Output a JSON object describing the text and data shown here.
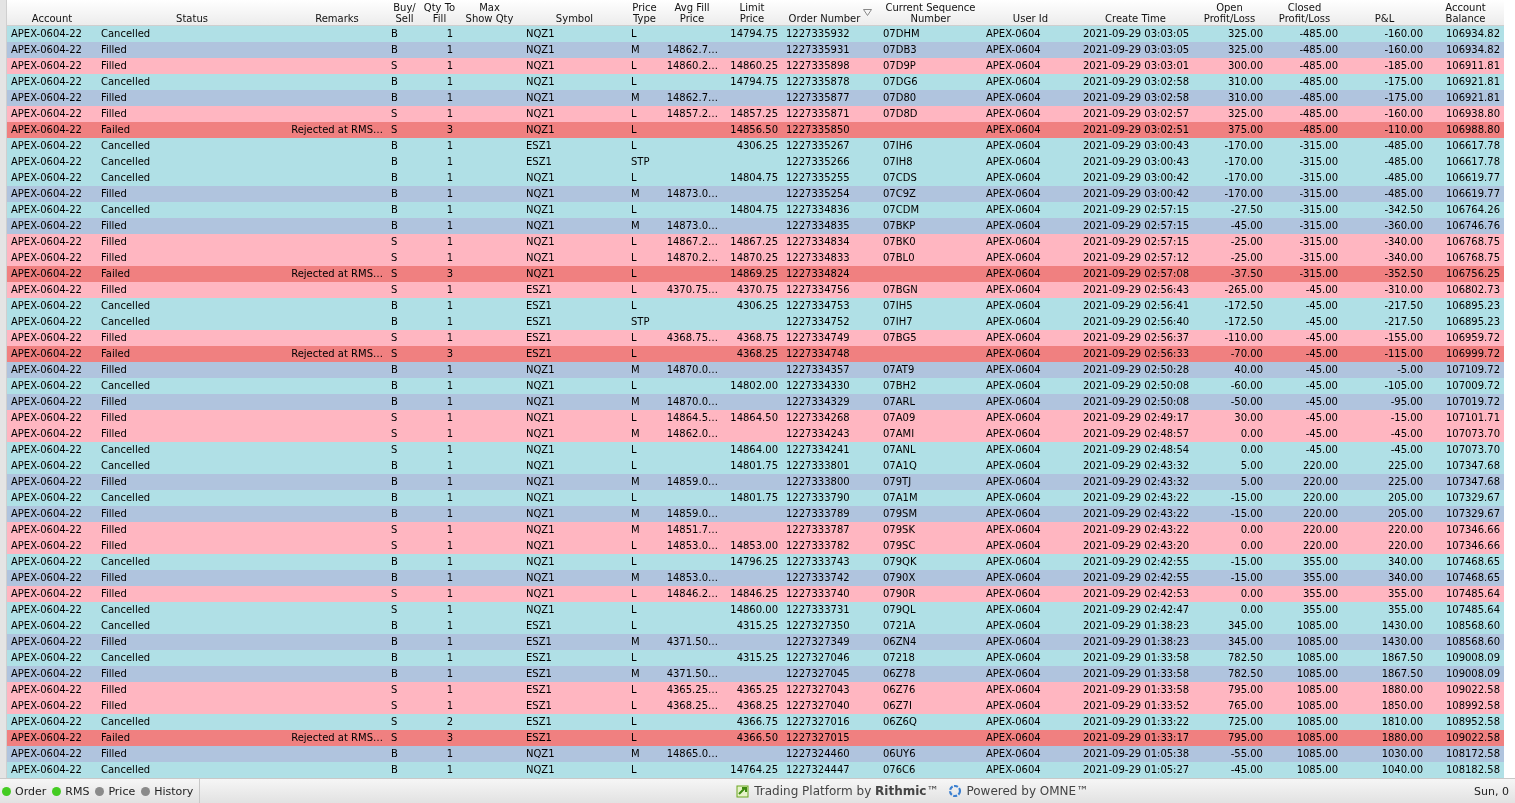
{
  "columns": [
    {
      "label": "Account",
      "sorted": false
    },
    {
      "label": "Status",
      "sorted": false
    },
    {
      "label": "Remarks",
      "sorted": false
    },
    {
      "label": "Buy/\nSell",
      "sorted": false
    },
    {
      "label": "Qty To\nFill",
      "sorted": false
    },
    {
      "label": "Max\nShow Qty",
      "sorted": false
    },
    {
      "label": "Symbol",
      "sorted": false
    },
    {
      "label": "Price\nType",
      "sorted": false
    },
    {
      "label": "Avg Fill\nPrice",
      "sorted": false
    },
    {
      "label": "Limit\nPrice",
      "sorted": false
    },
    {
      "label": "Order Number",
      "sorted": true
    },
    {
      "label": "Current Sequence\nNumber",
      "sorted": false
    },
    {
      "label": "User Id",
      "sorted": false
    },
    {
      "label": "Create Time",
      "sorted": false
    },
    {
      "label": "Open\nProfit/Loss",
      "sorted": false
    },
    {
      "label": "Closed\nProfit/Loss",
      "sorted": false
    },
    {
      "label": "P&L",
      "sorted": false
    },
    {
      "label": "Account\nBalance",
      "sorted": false
    }
  ],
  "rows": [
    {
      "color": "#b0e0e6",
      "cells": [
        "APEX-0604-22",
        "Cancelled",
        null,
        "B",
        "1",
        null,
        "NQZ1",
        "L",
        null,
        "14794.75",
        "1227335932",
        "07DHM",
        "APEX-0604",
        "2021-09-29 03:03:05",
        "325.00",
        "-485.00",
        "-160.00",
        "106934.82"
      ]
    },
    {
      "color": "#b0c4de",
      "cells": [
        "APEX-0604-22",
        "Filled",
        null,
        "B",
        "1",
        null,
        "NQZ1",
        "M",
        "14862.7…",
        null,
        "1227335931",
        "07DB3",
        "APEX-0604",
        "2021-09-29 03:03:05",
        "325.00",
        "-485.00",
        "-160.00",
        "106934.82"
      ]
    },
    {
      "color": "#ffb6c1",
      "cells": [
        "APEX-0604-22",
        "Filled",
        null,
        "S",
        "1",
        null,
        "NQZ1",
        "L",
        "14860.2…",
        "14860.25",
        "1227335898",
        "07D9P",
        "APEX-0604",
        "2021-09-29 03:03:01",
        "300.00",
        "-485.00",
        "-185.00",
        "106911.81"
      ]
    },
    {
      "color": "#b0e0e6",
      "cells": [
        "APEX-0604-22",
        "Cancelled",
        null,
        "B",
        "1",
        null,
        "NQZ1",
        "L",
        null,
        "14794.75",
        "1227335878",
        "07DG6",
        "APEX-0604",
        "2021-09-29 03:02:58",
        "310.00",
        "-485.00",
        "-175.00",
        "106921.81"
      ]
    },
    {
      "color": "#b0c4de",
      "cells": [
        "APEX-0604-22",
        "Filled",
        null,
        "B",
        "1",
        null,
        "NQZ1",
        "M",
        "14862.7…",
        null,
        "1227335877",
        "07D80",
        "APEX-0604",
        "2021-09-29 03:02:58",
        "310.00",
        "-485.00",
        "-175.00",
        "106921.81"
      ]
    },
    {
      "color": "#ffb6c1",
      "cells": [
        "APEX-0604-22",
        "Filled",
        null,
        "S",
        "1",
        null,
        "NQZ1",
        "L",
        "14857.2…",
        "14857.25",
        "1227335871",
        "07D8D",
        "APEX-0604",
        "2021-09-29 03:02:57",
        "325.00",
        "-485.00",
        "-160.00",
        "106938.80"
      ]
    },
    {
      "color": "#f08080",
      "cells": [
        "APEX-0604-22",
        "Failed",
        "Rejected at RMS…",
        "S",
        "3",
        null,
        "NQZ1",
        "L",
        null,
        "14856.50",
        "1227335850",
        null,
        "APEX-0604",
        "2021-09-29 03:02:51",
        "375.00",
        "-485.00",
        "-110.00",
        "106988.80"
      ]
    },
    {
      "color": "#b0e0e6",
      "cells": [
        "APEX-0604-22",
        "Cancelled",
        null,
        "B",
        "1",
        null,
        "ESZ1",
        "L",
        null,
        "4306.25",
        "1227335267",
        "07IH6",
        "APEX-0604",
        "2021-09-29 03:00:43",
        "-170.00",
        "-315.00",
        "-485.00",
        "106617.78"
      ]
    },
    {
      "color": "#b0e0e6",
      "cells": [
        "APEX-0604-22",
        "Cancelled",
        null,
        "B",
        "1",
        null,
        "ESZ1",
        "STP",
        null,
        null,
        "1227335266",
        "07IH8",
        "APEX-0604",
        "2021-09-29 03:00:43",
        "-170.00",
        "-315.00",
        "-485.00",
        "106617.78"
      ]
    },
    {
      "color": "#b0e0e6",
      "cells": [
        "APEX-0604-22",
        "Cancelled",
        null,
        "B",
        "1",
        null,
        "NQZ1",
        "L",
        null,
        "14804.75",
        "1227335255",
        "07CDS",
        "APEX-0604",
        "2021-09-29 03:00:42",
        "-170.00",
        "-315.00",
        "-485.00",
        "106619.77"
      ]
    },
    {
      "color": "#b0c4de",
      "cells": [
        "APEX-0604-22",
        "Filled",
        null,
        "B",
        "1",
        null,
        "NQZ1",
        "M",
        "14873.0…",
        null,
        "1227335254",
        "07C9Z",
        "APEX-0604",
        "2021-09-29 03:00:42",
        "-170.00",
        "-315.00",
        "-485.00",
        "106619.77"
      ]
    },
    {
      "color": "#b0e0e6",
      "cells": [
        "APEX-0604-22",
        "Cancelled",
        null,
        "B",
        "1",
        null,
        "NQZ1",
        "L",
        null,
        "14804.75",
        "1227334836",
        "07CDM",
        "APEX-0604",
        "2021-09-29 02:57:15",
        "-27.50",
        "-315.00",
        "-342.50",
        "106764.26"
      ]
    },
    {
      "color": "#b0c4de",
      "cells": [
        "APEX-0604-22",
        "Filled",
        null,
        "B",
        "1",
        null,
        "NQZ1",
        "M",
        "14873.0…",
        null,
        "1227334835",
        "07BKP",
        "APEX-0604",
        "2021-09-29 02:57:15",
        "-45.00",
        "-315.00",
        "-360.00",
        "106746.76"
      ]
    },
    {
      "color": "#ffb6c1",
      "cells": [
        "APEX-0604-22",
        "Filled",
        null,
        "S",
        "1",
        null,
        "NQZ1",
        "L",
        "14867.2…",
        "14867.25",
        "1227334834",
        "07BK0",
        "APEX-0604",
        "2021-09-29 02:57:15",
        "-25.00",
        "-315.00",
        "-340.00",
        "106768.75"
      ]
    },
    {
      "color": "#ffb6c1",
      "cells": [
        "APEX-0604-22",
        "Filled",
        null,
        "S",
        "1",
        null,
        "NQZ1",
        "L",
        "14870.2…",
        "14870.25",
        "1227334833",
        "07BL0",
        "APEX-0604",
        "2021-09-29 02:57:12",
        "-25.00",
        "-315.00",
        "-340.00",
        "106768.75"
      ]
    },
    {
      "color": "#f08080",
      "cells": [
        "APEX-0604-22",
        "Failed",
        "Rejected at RMS…",
        "S",
        "3",
        null,
        "NQZ1",
        "L",
        null,
        "14869.25",
        "1227334824",
        null,
        "APEX-0604",
        "2021-09-29 02:57:08",
        "-37.50",
        "-315.00",
        "-352.50",
        "106756.25"
      ]
    },
    {
      "color": "#ffb6c1",
      "cells": [
        "APEX-0604-22",
        "Filled",
        null,
        "S",
        "1",
        null,
        "ESZ1",
        "L",
        "4370.75…",
        "4370.75",
        "1227334756",
        "07BGN",
        "APEX-0604",
        "2021-09-29 02:56:43",
        "-265.00",
        "-45.00",
        "-310.00",
        "106802.73"
      ]
    },
    {
      "color": "#b0e0e6",
      "cells": [
        "APEX-0604-22",
        "Cancelled",
        null,
        "B",
        "1",
        null,
        "ESZ1",
        "L",
        null,
        "4306.25",
        "1227334753",
        "07IH5",
        "APEX-0604",
        "2021-09-29 02:56:41",
        "-172.50",
        "-45.00",
        "-217.50",
        "106895.23"
      ]
    },
    {
      "color": "#b0e0e6",
      "cells": [
        "APEX-0604-22",
        "Cancelled",
        null,
        "B",
        "1",
        null,
        "ESZ1",
        "STP",
        null,
        null,
        "1227334752",
        "07IH7",
        "APEX-0604",
        "2021-09-29 02:56:40",
        "-172.50",
        "-45.00",
        "-217.50",
        "106895.23"
      ]
    },
    {
      "color": "#ffb6c1",
      "cells": [
        "APEX-0604-22",
        "Filled",
        null,
        "S",
        "1",
        null,
        "ESZ1",
        "L",
        "4368.75…",
        "4368.75",
        "1227334749",
        "07BG5",
        "APEX-0604",
        "2021-09-29 02:56:37",
        "-110.00",
        "-45.00",
        "-155.00",
        "106959.72"
      ]
    },
    {
      "color": "#f08080",
      "cells": [
        "APEX-0604-22",
        "Failed",
        "Rejected at RMS…",
        "S",
        "3",
        null,
        "ESZ1",
        "L",
        null,
        "4368.25",
        "1227334748",
        null,
        "APEX-0604",
        "2021-09-29 02:56:33",
        "-70.00",
        "-45.00",
        "-115.00",
        "106999.72"
      ]
    },
    {
      "color": "#b0c4de",
      "cells": [
        "APEX-0604-22",
        "Filled",
        null,
        "B",
        "1",
        null,
        "NQZ1",
        "M",
        "14870.0…",
        null,
        "1227334357",
        "07AT9",
        "APEX-0604",
        "2021-09-29 02:50:28",
        "40.00",
        "-45.00",
        "-5.00",
        "107109.72"
      ]
    },
    {
      "color": "#b0e0e6",
      "cells": [
        "APEX-0604-22",
        "Cancelled",
        null,
        "B",
        "1",
        null,
        "NQZ1",
        "L",
        null,
        "14802.00",
        "1227334330",
        "07BH2",
        "APEX-0604",
        "2021-09-29 02:50:08",
        "-60.00",
        "-45.00",
        "-105.00",
        "107009.72"
      ]
    },
    {
      "color": "#b0c4de",
      "cells": [
        "APEX-0604-22",
        "Filled",
        null,
        "B",
        "1",
        null,
        "NQZ1",
        "M",
        "14870.0…",
        null,
        "1227334329",
        "07ARL",
        "APEX-0604",
        "2021-09-29 02:50:08",
        "-50.00",
        "-45.00",
        "-95.00",
        "107019.72"
      ]
    },
    {
      "color": "#ffb6c1",
      "cells": [
        "APEX-0604-22",
        "Filled",
        null,
        "S",
        "1",
        null,
        "NQZ1",
        "L",
        "14864.5…",
        "14864.50",
        "1227334268",
        "07A09",
        "APEX-0604",
        "2021-09-29 02:49:17",
        "30.00",
        "-45.00",
        "-15.00",
        "107101.71"
      ]
    },
    {
      "color": "#ffb6c1",
      "cells": [
        "APEX-0604-22",
        "Filled",
        null,
        "S",
        "1",
        null,
        "NQZ1",
        "M",
        "14862.0…",
        null,
        "1227334243",
        "07AMI",
        "APEX-0604",
        "2021-09-29 02:48:57",
        "0.00",
        "-45.00",
        "-45.00",
        "107073.70"
      ]
    },
    {
      "color": "#b0e0e6",
      "cells": [
        "APEX-0604-22",
        "Cancelled",
        null,
        "S",
        "1",
        null,
        "NQZ1",
        "L",
        null,
        "14864.00",
        "1227334241",
        "07ANL",
        "APEX-0604",
        "2021-09-29 02:48:54",
        "0.00",
        "-45.00",
        "-45.00",
        "107073.70"
      ]
    },
    {
      "color": "#b0e0e6",
      "cells": [
        "APEX-0604-22",
        "Cancelled",
        null,
        "B",
        "1",
        null,
        "NQZ1",
        "L",
        null,
        "14801.75",
        "1227333801",
        "07A1Q",
        "APEX-0604",
        "2021-09-29 02:43:32",
        "5.00",
        "220.00",
        "225.00",
        "107347.68"
      ]
    },
    {
      "color": "#b0c4de",
      "cells": [
        "APEX-0604-22",
        "Filled",
        null,
        "B",
        "1",
        null,
        "NQZ1",
        "M",
        "14859.0…",
        null,
        "1227333800",
        "079TJ",
        "APEX-0604",
        "2021-09-29 02:43:32",
        "5.00",
        "220.00",
        "225.00",
        "107347.68"
      ]
    },
    {
      "color": "#b0e0e6",
      "cells": [
        "APEX-0604-22",
        "Cancelled",
        null,
        "B",
        "1",
        null,
        "NQZ1",
        "L",
        null,
        "14801.75",
        "1227333790",
        "07A1M",
        "APEX-0604",
        "2021-09-29 02:43:22",
        "-15.00",
        "220.00",
        "205.00",
        "107329.67"
      ]
    },
    {
      "color": "#b0c4de",
      "cells": [
        "APEX-0604-22",
        "Filled",
        null,
        "B",
        "1",
        null,
        "NQZ1",
        "M",
        "14859.0…",
        null,
        "1227333789",
        "079SM",
        "APEX-0604",
        "2021-09-29 02:43:22",
        "-15.00",
        "220.00",
        "205.00",
        "107329.67"
      ]
    },
    {
      "color": "#ffb6c1",
      "cells": [
        "APEX-0604-22",
        "Filled",
        null,
        "S",
        "1",
        null,
        "NQZ1",
        "M",
        "14851.7…",
        null,
        "1227333787",
        "079SK",
        "APEX-0604",
        "2021-09-29 02:43:22",
        "0.00",
        "220.00",
        "220.00",
        "107346.66"
      ]
    },
    {
      "color": "#ffb6c1",
      "cells": [
        "APEX-0604-22",
        "Filled",
        null,
        "S",
        "1",
        null,
        "NQZ1",
        "L",
        "14853.0…",
        "14853.00",
        "1227333782",
        "079SC",
        "APEX-0604",
        "2021-09-29 02:43:20",
        "0.00",
        "220.00",
        "220.00",
        "107346.66"
      ]
    },
    {
      "color": "#b0e0e6",
      "cells": [
        "APEX-0604-22",
        "Cancelled",
        null,
        "B",
        "1",
        null,
        "NQZ1",
        "L",
        null,
        "14796.25",
        "1227333743",
        "079QK",
        "APEX-0604",
        "2021-09-29 02:42:55",
        "-15.00",
        "355.00",
        "340.00",
        "107468.65"
      ]
    },
    {
      "color": "#b0c4de",
      "cells": [
        "APEX-0604-22",
        "Filled",
        null,
        "B",
        "1",
        null,
        "NQZ1",
        "M",
        "14853.0…",
        null,
        "1227333742",
        "0790X",
        "APEX-0604",
        "2021-09-29 02:42:55",
        "-15.00",
        "355.00",
        "340.00",
        "107468.65"
      ]
    },
    {
      "color": "#ffb6c1",
      "cells": [
        "APEX-0604-22",
        "Filled",
        null,
        "S",
        "1",
        null,
        "NQZ1",
        "L",
        "14846.2…",
        "14846.25",
        "1227333740",
        "0790R",
        "APEX-0604",
        "2021-09-29 02:42:53",
        "0.00",
        "355.00",
        "355.00",
        "107485.64"
      ]
    },
    {
      "color": "#b0e0e6",
      "cells": [
        "APEX-0604-22",
        "Cancelled",
        null,
        "S",
        "1",
        null,
        "NQZ1",
        "L",
        null,
        "14860.00",
        "1227333731",
        "079QL",
        "APEX-0604",
        "2021-09-29 02:42:47",
        "0.00",
        "355.00",
        "355.00",
        "107485.64"
      ]
    },
    {
      "color": "#b0e0e6",
      "cells": [
        "APEX-0604-22",
        "Cancelled",
        null,
        "B",
        "1",
        null,
        "ESZ1",
        "L",
        null,
        "4315.25",
        "1227327350",
        "0721A",
        "APEX-0604",
        "2021-09-29 01:38:23",
        "345.00",
        "1085.00",
        "1430.00",
        "108568.60"
      ]
    },
    {
      "color": "#b0c4de",
      "cells": [
        "APEX-0604-22",
        "Filled",
        null,
        "B",
        "1",
        null,
        "ESZ1",
        "M",
        "4371.50…",
        null,
        "1227327349",
        "06ZN4",
        "APEX-0604",
        "2021-09-29 01:38:23",
        "345.00",
        "1085.00",
        "1430.00",
        "108568.60"
      ]
    },
    {
      "color": "#b0e0e6",
      "cells": [
        "APEX-0604-22",
        "Cancelled",
        null,
        "B",
        "1",
        null,
        "ESZ1",
        "L",
        null,
        "4315.25",
        "1227327046",
        "07218",
        "APEX-0604",
        "2021-09-29 01:33:58",
        "782.50",
        "1085.00",
        "1867.50",
        "109008.09"
      ]
    },
    {
      "color": "#b0c4de",
      "cells": [
        "APEX-0604-22",
        "Filled",
        null,
        "B",
        "1",
        null,
        "ESZ1",
        "M",
        "4371.50…",
        null,
        "1227327045",
        "06Z78",
        "APEX-0604",
        "2021-09-29 01:33:58",
        "782.50",
        "1085.00",
        "1867.50",
        "109008.09"
      ]
    },
    {
      "color": "#ffb6c1",
      "cells": [
        "APEX-0604-22",
        "Filled",
        null,
        "S",
        "1",
        null,
        "ESZ1",
        "L",
        "4365.25…",
        "4365.25",
        "1227327043",
        "06Z76",
        "APEX-0604",
        "2021-09-29 01:33:58",
        "795.00",
        "1085.00",
        "1880.00",
        "109022.58"
      ]
    },
    {
      "color": "#ffb6c1",
      "cells": [
        "APEX-0604-22",
        "Filled",
        null,
        "S",
        "1",
        null,
        "ESZ1",
        "L",
        "4368.25…",
        "4368.25",
        "1227327040",
        "06Z7I",
        "APEX-0604",
        "2021-09-29 01:33:52",
        "765.00",
        "1085.00",
        "1850.00",
        "108992.58"
      ]
    },
    {
      "color": "#b0e0e6",
      "cells": [
        "APEX-0604-22",
        "Cancelled",
        null,
        "S",
        "2",
        null,
        "ESZ1",
        "L",
        null,
        "4366.75",
        "1227327016",
        "06Z6Q",
        "APEX-0604",
        "2021-09-29 01:33:22",
        "725.00",
        "1085.00",
        "1810.00",
        "108952.58"
      ]
    },
    {
      "color": "#f08080",
      "cells": [
        "APEX-0604-22",
        "Failed",
        "Rejected at RMS…",
        "S",
        "3",
        null,
        "ESZ1",
        "L",
        null,
        "4366.50",
        "1227327015",
        null,
        "APEX-0604",
        "2021-09-29 01:33:17",
        "795.00",
        "1085.00",
        "1880.00",
        "109022.58"
      ]
    },
    {
      "color": "#b0c4de",
      "cells": [
        "APEX-0604-22",
        "Filled",
        null,
        "B",
        "1",
        null,
        "NQZ1",
        "M",
        "14865.0…",
        null,
        "1227324460",
        "06UY6",
        "APEX-0604",
        "2021-09-29 01:05:38",
        "-55.00",
        "1085.00",
        "1030.00",
        "108172.58"
      ]
    },
    {
      "color": "#b0e0e6",
      "cells": [
        "APEX-0604-22",
        "Cancelled",
        null,
        "B",
        "1",
        null,
        "NQZ1",
        "L",
        null,
        "14764.25",
        "1227324447",
        "076C6",
        "APEX-0604",
        "2021-09-29 01:05:27",
        "-45.00",
        "1085.00",
        "1040.00",
        "108182.58"
      ]
    }
  ],
  "status_bar": {
    "connections": [
      {
        "label": "Order",
        "color": "#44cc22"
      },
      {
        "label": "RMS",
        "color": "#44cc22"
      },
      {
        "label": "Price",
        "color": "#8a8a8a"
      },
      {
        "label": "History",
        "color": "#8a8a8a"
      }
    ],
    "branding": [
      {
        "kind": "square-logo",
        "text": "Trading Platform by **Rithmic**™"
      },
      {
        "kind": "ring-logo",
        "text": "Powered by OMNE™"
      }
    ],
    "date": "Sun, 0"
  }
}
